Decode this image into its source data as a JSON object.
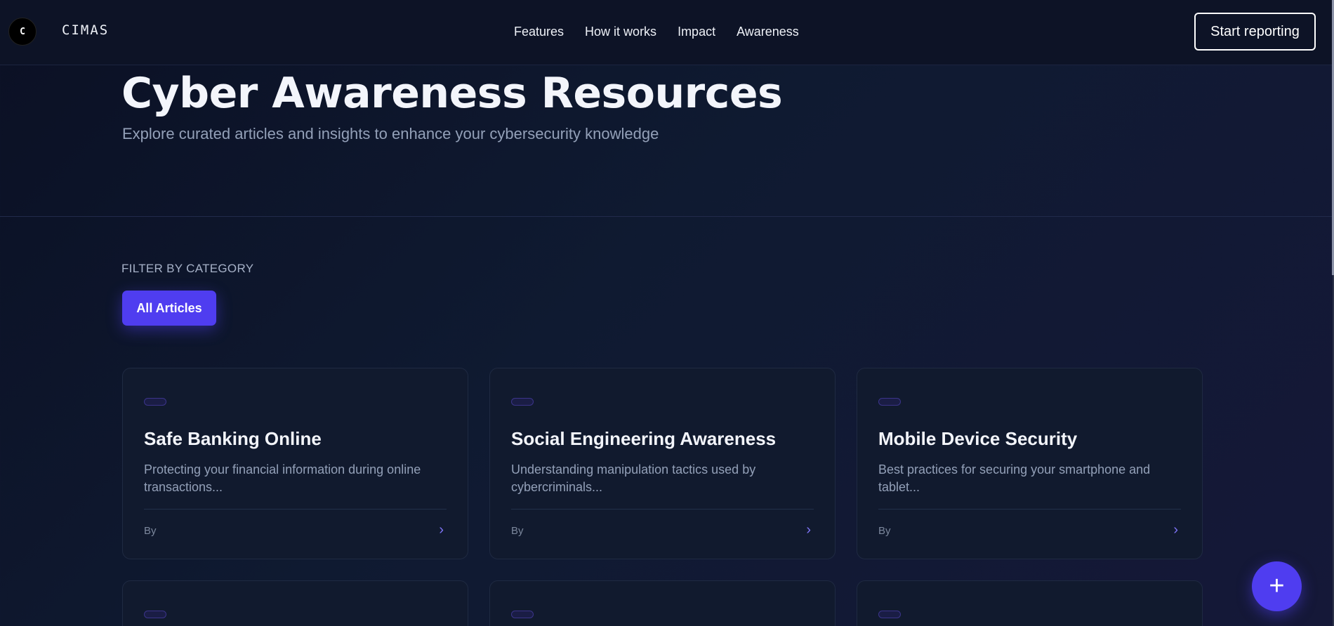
{
  "header": {
    "logo_glyph": "C",
    "brand": "CIMAS",
    "nav": [
      "Features",
      "How it works",
      "Impact",
      "Awareness"
    ],
    "cta_label": "Start reporting"
  },
  "hero": {
    "title": "Cyber Awareness Resources",
    "subtitle": "Explore curated articles and insights to enhance your cybersecurity knowledge"
  },
  "filter": {
    "label": "FILTER BY CATEGORY",
    "active_chip": "All Articles"
  },
  "cards": [
    {
      "title": "Safe Banking Online",
      "excerpt": "Protecting your financial information during online transactions...",
      "byline": "By",
      "arrow": "›"
    },
    {
      "title": "Social Engineering Awareness",
      "excerpt": "Understanding manipulation tactics used by cybercriminals...",
      "byline": "By",
      "arrow": "›"
    },
    {
      "title": "Mobile Device Security",
      "excerpt": "Best practices for securing your smartphone and tablet...",
      "byline": "By",
      "arrow": "›"
    }
  ],
  "fab": {
    "label": "+",
    "icon": "plus-icon"
  },
  "colors": {
    "accent": "#4f3df0",
    "background": "#0b1024",
    "card": "#111a2e"
  }
}
